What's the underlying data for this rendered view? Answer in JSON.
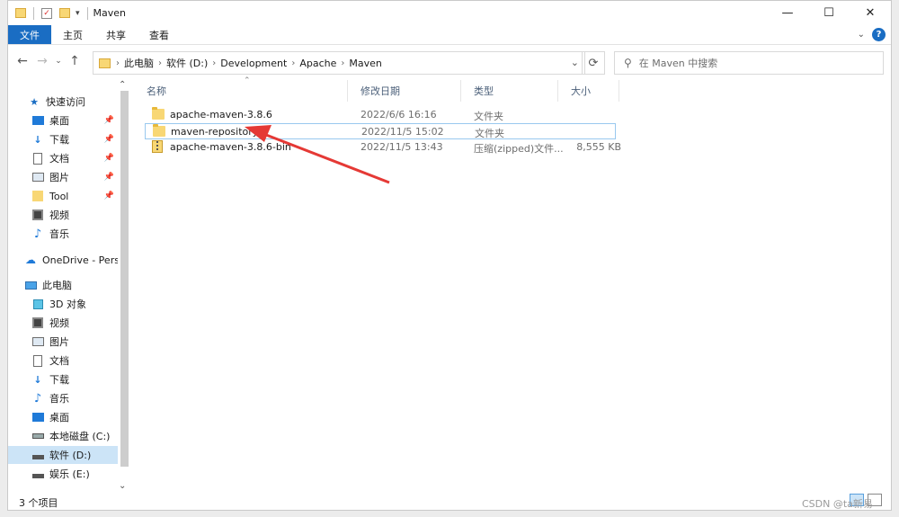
{
  "window": {
    "title": "Maven"
  },
  "ribbon": {
    "file": "文件",
    "tabs": [
      "主页",
      "共享",
      "查看"
    ]
  },
  "address": {
    "crumbs": [
      "此电脑",
      "软件 (D:)",
      "Development",
      "Apache",
      "Maven"
    ]
  },
  "search": {
    "placeholder": "在 Maven 中搜索"
  },
  "sidebar": {
    "quick_access": "快速访问",
    "quick_items": [
      "桌面",
      "下载",
      "文档",
      "图片",
      "Tool",
      "视频",
      "音乐"
    ],
    "onedrive": "OneDrive - Perso",
    "this_pc": "此电脑",
    "pc_items": [
      "3D 对象",
      "视频",
      "图片",
      "文档",
      "下载",
      "音乐",
      "桌面",
      "本地磁盘 (C:)",
      "软件 (D:)",
      "娱乐 (E:)"
    ]
  },
  "columns": {
    "name": "名称",
    "date": "修改日期",
    "type": "类型",
    "size": "大小"
  },
  "files": [
    {
      "name": "apache-maven-3.8.6",
      "date": "2022/6/6 16:16",
      "type": "文件夹",
      "size": ""
    },
    {
      "name": "maven-repository",
      "date": "2022/11/5 15:02",
      "type": "文件夹",
      "size": ""
    },
    {
      "name": "apache-maven-3.8.6-bin",
      "date": "2022/11/5 13:43",
      "type": "压缩(zipped)文件...",
      "size": "8,555 KB"
    }
  ],
  "status": {
    "count": "3 个项目"
  },
  "watermark": "CSDN @ta新易",
  "colors": {
    "accent": "#1a6dc3",
    "selection": "#cce4f7",
    "folder": "#f8d775",
    "arrow": "#e53935"
  }
}
